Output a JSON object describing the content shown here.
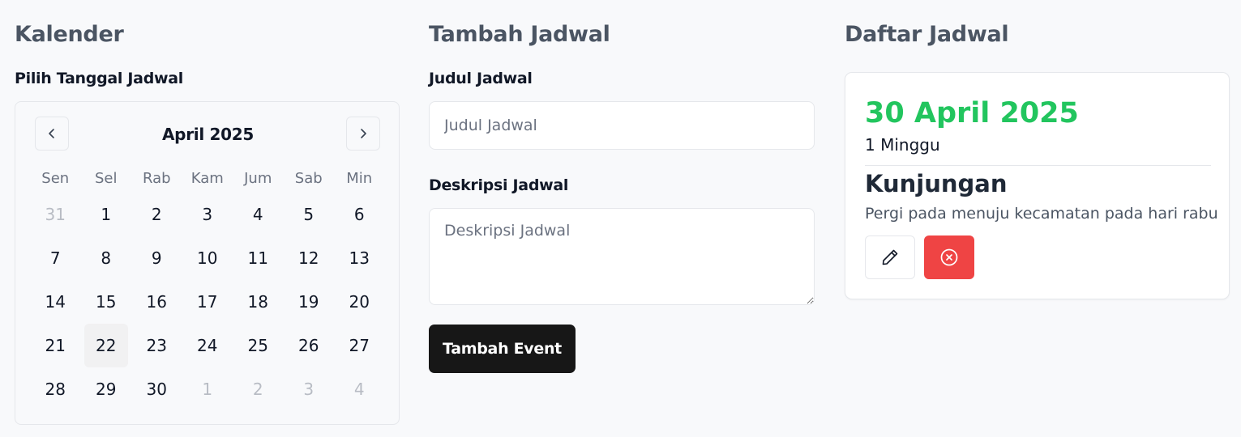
{
  "calendar": {
    "section_title": "Kalender",
    "label": "Pilih Tanggal Jadwal",
    "month": "April 2025",
    "weekdays": [
      "Sen",
      "Sel",
      "Rab",
      "Kam",
      "Jum",
      "Sab",
      "Min"
    ],
    "days": [
      {
        "d": "31",
        "muted": true
      },
      {
        "d": "1"
      },
      {
        "d": "2"
      },
      {
        "d": "3"
      },
      {
        "d": "4"
      },
      {
        "d": "5"
      },
      {
        "d": "6"
      },
      {
        "d": "7"
      },
      {
        "d": "8"
      },
      {
        "d": "9"
      },
      {
        "d": "10"
      },
      {
        "d": "11"
      },
      {
        "d": "12"
      },
      {
        "d": "13"
      },
      {
        "d": "14"
      },
      {
        "d": "15"
      },
      {
        "d": "16"
      },
      {
        "d": "17"
      },
      {
        "d": "18"
      },
      {
        "d": "19"
      },
      {
        "d": "20"
      },
      {
        "d": "21"
      },
      {
        "d": "22",
        "today": true
      },
      {
        "d": "23"
      },
      {
        "d": "24"
      },
      {
        "d": "25"
      },
      {
        "d": "26"
      },
      {
        "d": "27"
      },
      {
        "d": "28"
      },
      {
        "d": "29"
      },
      {
        "d": "30"
      },
      {
        "d": "1",
        "muted": true
      },
      {
        "d": "2",
        "muted": true
      },
      {
        "d": "3",
        "muted": true
      },
      {
        "d": "4",
        "muted": true
      }
    ],
    "prev_icon": "chevron-left-icon",
    "next_icon": "chevron-right-icon"
  },
  "form": {
    "section_title": "Tambah Jadwal",
    "title_label": "Judul Jadwal",
    "title_placeholder": "Judul Jadwal",
    "title_value": "",
    "desc_label": "Deskripsi Jadwal",
    "desc_placeholder": "Deskripsi Jadwal",
    "desc_value": "",
    "submit_label": "Tambah Event"
  },
  "schedule": {
    "section_title": "Daftar Jadwal",
    "items": [
      {
        "date": "30 April 2025",
        "duration": "1 Minggu",
        "title": "Kunjungan",
        "description": "Pergi pada menuju kecamatan pada hari rabu",
        "edit_icon": "pencil-icon",
        "delete_icon": "x-circle-icon"
      }
    ]
  },
  "colors": {
    "accent_green": "#22c55e",
    "danger_red": "#ef4444",
    "button_dark": "#171717",
    "background": "#f8f9fb"
  }
}
